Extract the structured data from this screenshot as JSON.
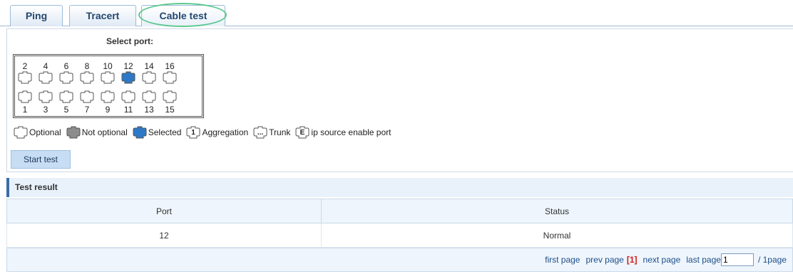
{
  "tabs": [
    {
      "label": "Ping"
    },
    {
      "label": "Tracert"
    },
    {
      "label": "Cable test",
      "active": true
    }
  ],
  "select_port": {
    "label": "Select port:",
    "top_row": [
      {
        "number": "2",
        "state": "optional"
      },
      {
        "number": "4",
        "state": "optional"
      },
      {
        "number": "6",
        "state": "optional"
      },
      {
        "number": "8",
        "state": "optional"
      },
      {
        "number": "10",
        "state": "optional"
      },
      {
        "number": "12",
        "state": "selected"
      },
      {
        "number": "14",
        "state": "optional"
      },
      {
        "number": "16",
        "state": "optional"
      }
    ],
    "bottom_row": [
      {
        "number": "1",
        "state": "optional"
      },
      {
        "number": "3",
        "state": "optional"
      },
      {
        "number": "5",
        "state": "optional"
      },
      {
        "number": "7",
        "state": "optional"
      },
      {
        "number": "9",
        "state": "optional"
      },
      {
        "number": "11",
        "state": "optional"
      },
      {
        "number": "13",
        "state": "optional"
      },
      {
        "number": "15",
        "state": "optional"
      }
    ]
  },
  "legend": [
    {
      "label": "Optional",
      "icon": "port-optional-icon"
    },
    {
      "label": "Not optional",
      "icon": "port-not-optional-icon"
    },
    {
      "label": "Selected",
      "icon": "port-selected-icon"
    },
    {
      "label": "Aggregation",
      "icon": "port-aggregation-icon",
      "glyph": "1"
    },
    {
      "label": "Trunk",
      "icon": "port-trunk-icon",
      "glyph": "..."
    },
    {
      "label": "ip source enable port",
      "icon": "port-ip-source-icon",
      "glyph": "E"
    }
  ],
  "start_button": "Start test",
  "result": {
    "title": "Test result",
    "columns": [
      "Port",
      "Status"
    ],
    "rows": [
      {
        "port": "12",
        "status": "Normal"
      }
    ]
  },
  "pager": {
    "first": "first page",
    "prev": "prev page",
    "current": "[1]",
    "next": "next page",
    "last": "last page",
    "page_input": "1",
    "total": "/ 1page"
  },
  "colors": {
    "optional_fill": "#ffffff",
    "not_optional_fill": "#8c8c8c",
    "selected_fill": "#2e79c7",
    "accent": "#3a6ea5",
    "highlight_oval": "#5cc88f"
  }
}
